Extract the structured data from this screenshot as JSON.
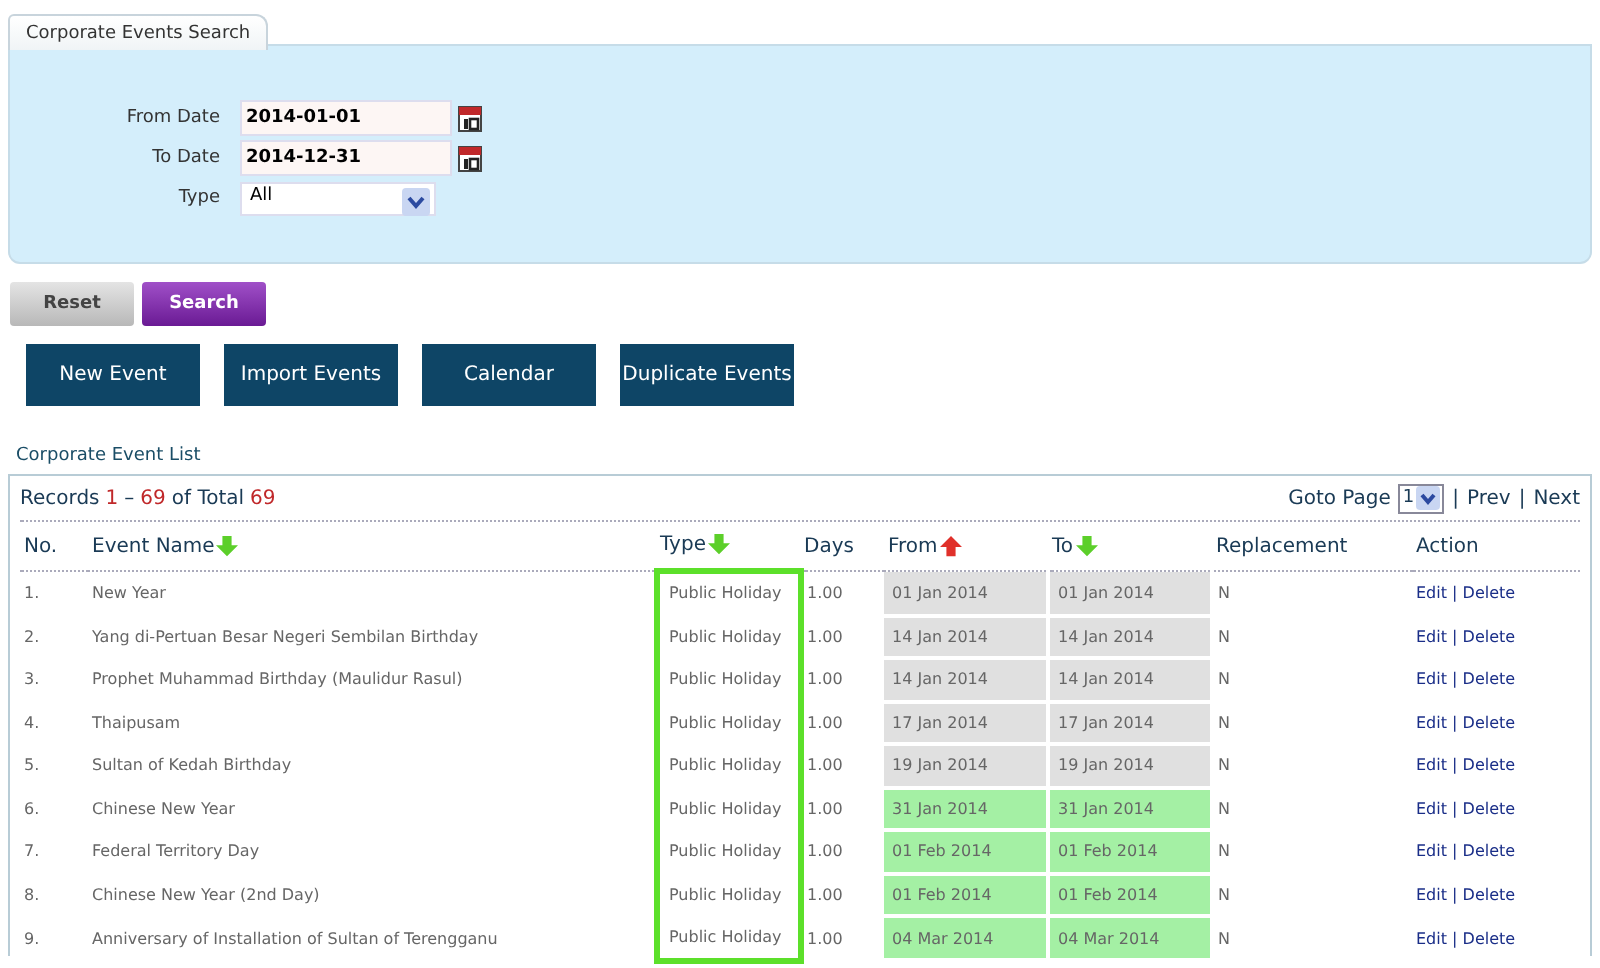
{
  "tab": {
    "label": "Corporate Events Search",
    "selected": true
  },
  "search": {
    "fields": [
      {
        "label": "From Date",
        "kind": "date",
        "value": "2014-01-01"
      },
      {
        "label": "To Date",
        "kind": "date",
        "value": "2014-12-31"
      },
      {
        "label": "Type",
        "kind": "select",
        "value": "All"
      }
    ],
    "buttons": [
      {
        "label": "Reset",
        "kind": "secondary"
      },
      {
        "label": "Search",
        "kind": "primary"
      }
    ]
  },
  "actions": [
    "New Event",
    "Import Events",
    "Calendar",
    "Duplicate Events"
  ],
  "section_title": "Corporate Event List",
  "table": {
    "records": [
      {
        "text": "Records",
        "kind": "label"
      },
      {
        "text": "1",
        "kind": "number"
      },
      {
        "text": "–",
        "kind": "label"
      },
      {
        "text": "69",
        "kind": "number"
      },
      {
        "text": "of Total",
        "kind": "label"
      },
      {
        "text": "69",
        "kind": "number"
      }
    ],
    "pager": {
      "label": "Goto Page",
      "page": "1",
      "separator_1": "|",
      "prev": "Prev",
      "separator_2": "|",
      "next": "Next"
    },
    "type_column_outlined": true,
    "columns": [
      {
        "label": "No.",
        "kind": "plain"
      },
      {
        "label": "Event Name",
        "kind": "sort_down"
      },
      {
        "label": "Type",
        "kind": "sort_down"
      },
      {
        "label": "Days",
        "kind": "plain"
      },
      {
        "label": "From",
        "kind": "sort_up"
      },
      {
        "label": "To",
        "kind": "sort_down"
      },
      {
        "label": "Replacement",
        "kind": "plain"
      },
      {
        "label": "Action",
        "kind": "plain"
      }
    ],
    "rows": [
      {
        "no": "1.",
        "name": "New Year",
        "type": "Public Holiday",
        "days": "1.00",
        "from": "01 Jan 2014",
        "to": "01 Jan 2014",
        "replacement": "N",
        "highlighted": false,
        "edit": "Edit",
        "separator": "|",
        "delete": "Delete"
      },
      {
        "no": "2.",
        "name": "Yang di-Pertuan Besar Negeri Sembilan Birthday",
        "type": "Public Holiday",
        "days": "1.00",
        "from": "14 Jan 2014",
        "to": "14 Jan 2014",
        "replacement": "N",
        "highlighted": false,
        "edit": "Edit",
        "separator": "|",
        "delete": "Delete"
      },
      {
        "no": "3.",
        "name": "Prophet Muhammad Birthday (Maulidur Rasul)",
        "type": "Public Holiday",
        "days": "1.00",
        "from": "14 Jan 2014",
        "to": "14 Jan 2014",
        "replacement": "N",
        "highlighted": false,
        "edit": "Edit",
        "separator": "|",
        "delete": "Delete"
      },
      {
        "no": "4.",
        "name": "Thaipusam",
        "type": "Public Holiday",
        "days": "1.00",
        "from": "17 Jan 2014",
        "to": "17 Jan 2014",
        "replacement": "N",
        "highlighted": false,
        "edit": "Edit",
        "separator": "|",
        "delete": "Delete"
      },
      {
        "no": "5.",
        "name": "Sultan of Kedah Birthday",
        "type": "Public Holiday",
        "days": "1.00",
        "from": "19 Jan 2014",
        "to": "19 Jan 2014",
        "replacement": "N",
        "highlighted": false,
        "edit": "Edit",
        "separator": "|",
        "delete": "Delete"
      },
      {
        "no": "6.",
        "name": "Chinese New Year",
        "type": "Public Holiday",
        "days": "1.00",
        "from": "31 Jan 2014",
        "to": "31 Jan 2014",
        "replacement": "N",
        "highlighted": true,
        "edit": "Edit",
        "separator": "|",
        "delete": "Delete"
      },
      {
        "no": "7.",
        "name": "Federal Territory Day",
        "type": "Public Holiday",
        "days": "1.00",
        "from": "01 Feb 2014",
        "to": "01 Feb 2014",
        "replacement": "N",
        "highlighted": true,
        "edit": "Edit",
        "separator": "|",
        "delete": "Delete"
      },
      {
        "no": "8.",
        "name": "Chinese New Year (2nd Day)",
        "type": "Public Holiday",
        "days": "1.00",
        "from": "01 Feb 2014",
        "to": "01 Feb 2014",
        "replacement": "N",
        "highlighted": true,
        "edit": "Edit",
        "separator": "|",
        "delete": "Delete"
      },
      {
        "no": "9.",
        "name": "Anniversary of Installation of Sultan of Terengganu",
        "type": "Public Holiday",
        "days": "1.00",
        "from": "04 Mar 2014",
        "to": "04 Mar 2014",
        "replacement": "N",
        "highlighted": true,
        "edit": "Edit",
        "separator": "|",
        "delete": "Delete"
      }
    ]
  }
}
